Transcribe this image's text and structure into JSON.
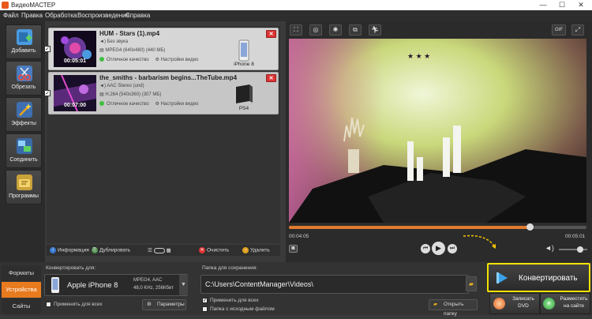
{
  "titlebar": {
    "title": "ВидеоМАСТЕР",
    "minimize": "—",
    "maximize": "☐",
    "close": "✕"
  },
  "menu": [
    "Файл",
    "Правка",
    "Обработка",
    "Воспроизведение",
    "Справка"
  ],
  "sidebar": [
    {
      "label": "Добавить",
      "icon": "add-film-icon",
      "color": "#4a9be0"
    },
    {
      "label": "Обрезать",
      "icon": "cut-icon",
      "color": "#e0504a"
    },
    {
      "label": "Эффекты",
      "icon": "effects-icon",
      "color": "#e8a21f"
    },
    {
      "label": "Соединить",
      "icon": "join-icon",
      "color": "#5aa8e0"
    },
    {
      "label": "Программы",
      "icon": "programs-icon",
      "color": "#e9c34a"
    }
  ],
  "files": [
    {
      "name": "HUM - Stars (1).mp4",
      "audio": "Без звука",
      "video": "MPEG4 (640x480) (440 МБ)",
      "quality": "Отличное качество",
      "settings": "Настройки видео",
      "duration": "00:05:01",
      "device": "iPhone 8"
    },
    {
      "name": "the_smiths - barbarism begins...TheTube.mp4",
      "audio": "AAC Stereo (und)",
      "video": "H.264 (540x360) (307 МБ)",
      "quality": "Отличное качество",
      "settings": "Настройки видео",
      "duration": "00:07:00",
      "device": "PS4"
    }
  ],
  "filetoolbar": {
    "info": "Информация",
    "duplicate": "Дублировать",
    "clear": "Очистить",
    "delete": "Удалить"
  },
  "player": {
    "current_time": "00:04:05",
    "total_time": "00:05:01",
    "progress": 0.81,
    "volume": 0.75
  },
  "bottom": {
    "tabs": [
      "Форматы",
      "Устройства",
      "Сайты"
    ],
    "active_tab": "Устройства",
    "convert_for_label": "Конвертировать для:",
    "device": "Apple iPhone 8",
    "device_format": "MPEG4, AAC",
    "device_audio": "48,0 KHz, 256Кбит",
    "apply_all": "Применить для всех",
    "params": "Параметры",
    "save_folder_label": "Папка для сохранения:",
    "path": "C:\\Users\\ContentManager\\Videos\\",
    "apply_all2": "Применить для всех",
    "source_folder": "Папка с исходным файлом",
    "open_folder": "Открыть папку",
    "convert": "Конвертировать",
    "burn_dvd_1": "Записать",
    "burn_dvd_2": "DVD",
    "upload_1": "Разместить",
    "upload_2": "на сайте"
  },
  "colors": {
    "accent": "#e97b1f",
    "highlight": "#f3e200"
  }
}
